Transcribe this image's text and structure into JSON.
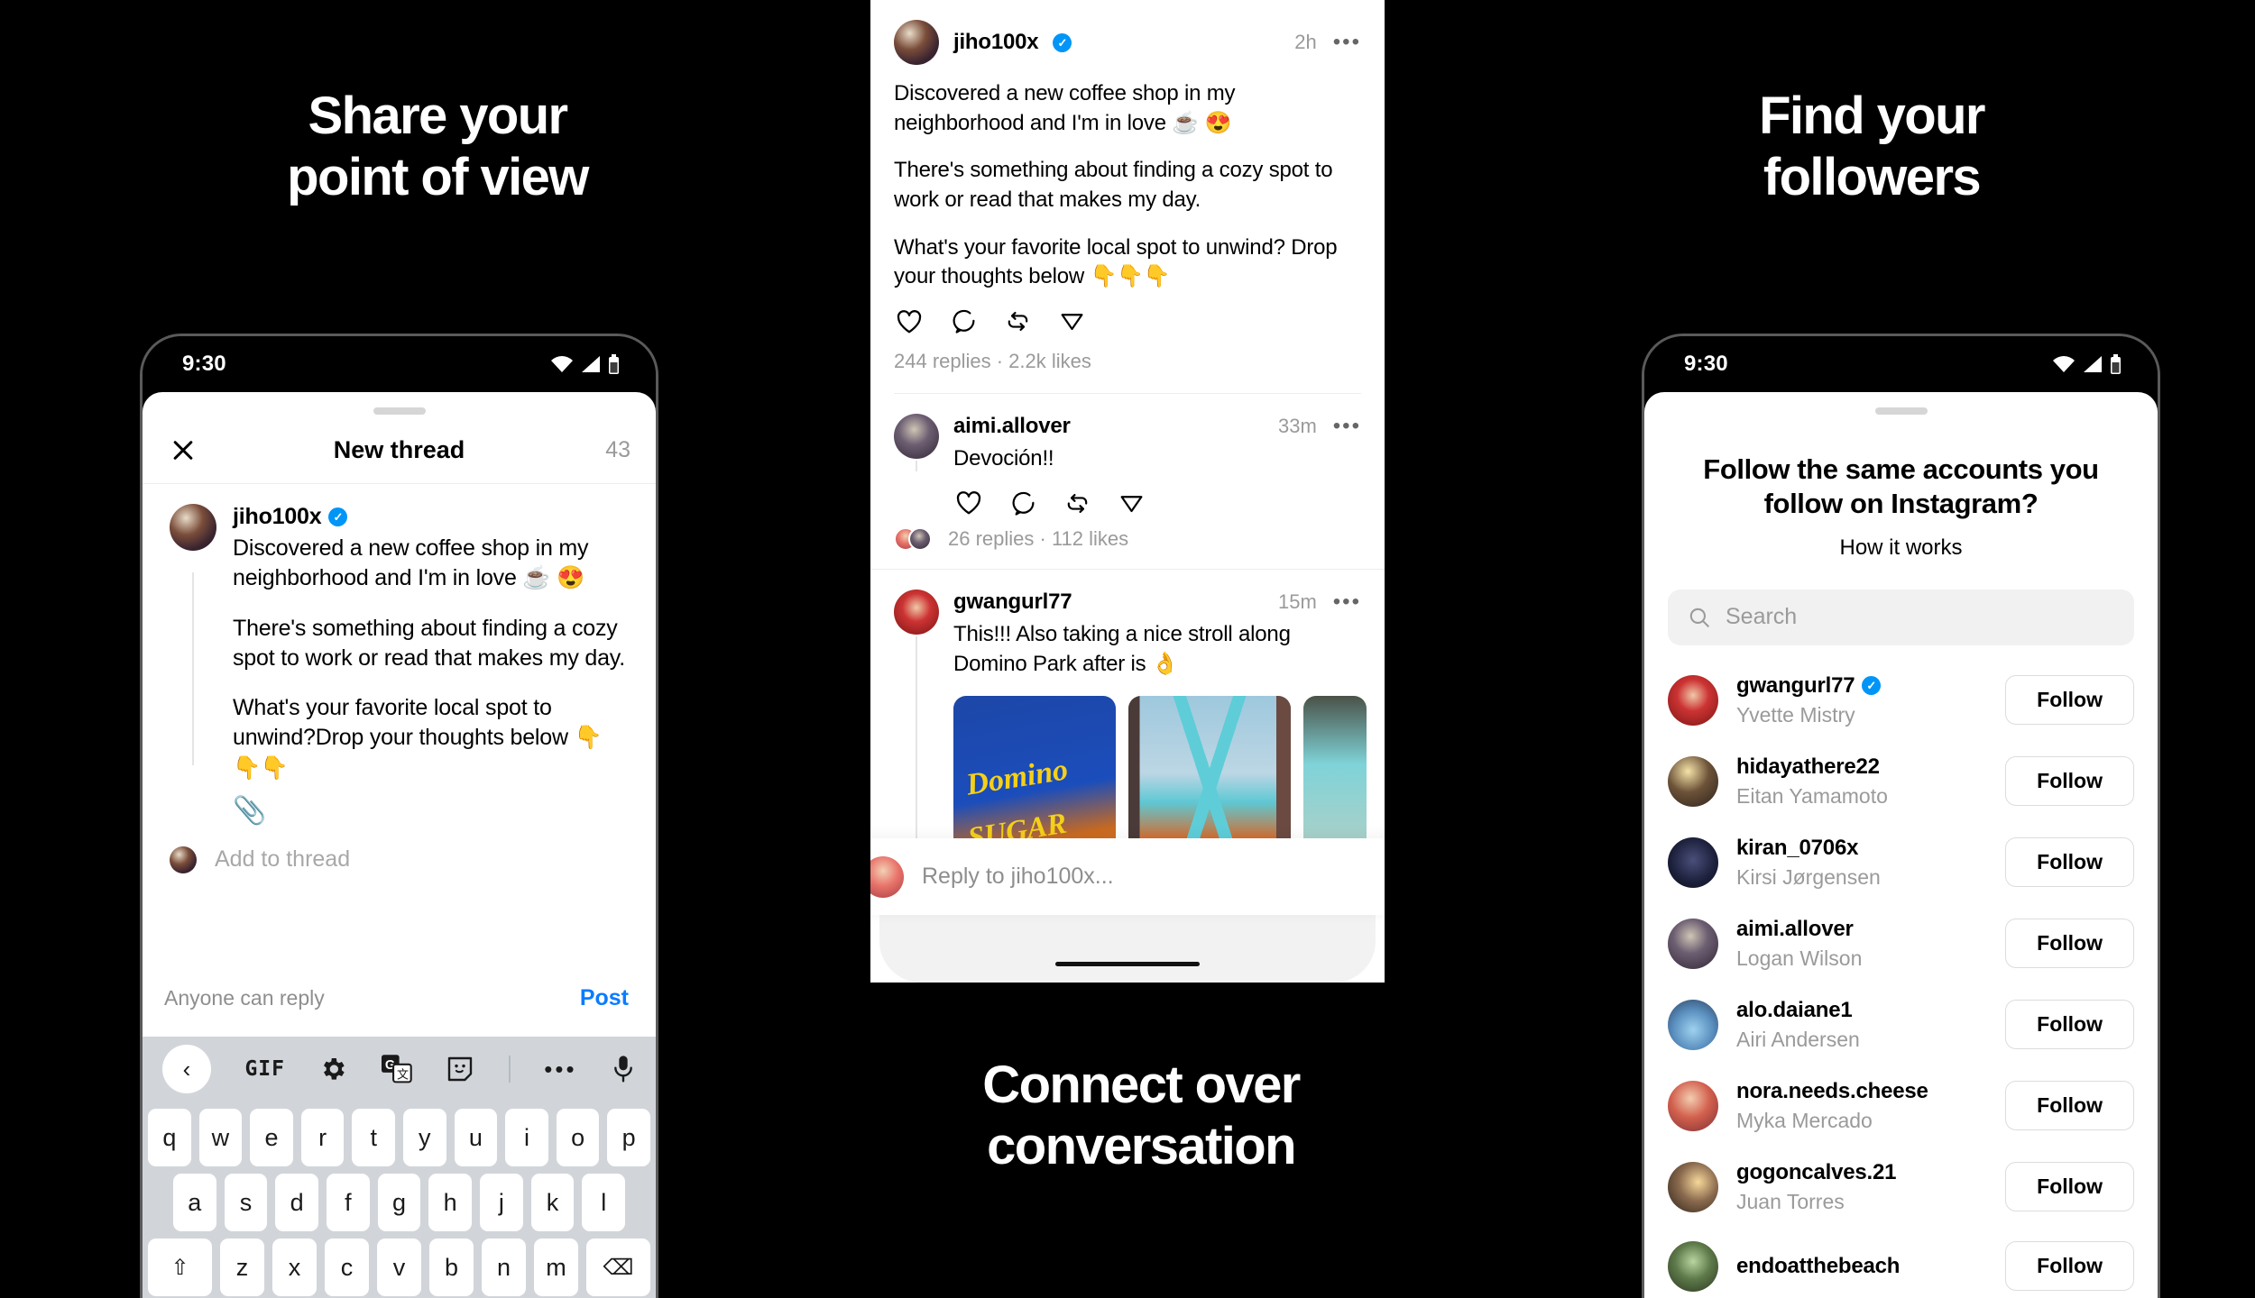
{
  "headlines": {
    "left": "Share your\npoint of view",
    "right": "Find your\nfollowers",
    "bottom": "Connect over\nconversation"
  },
  "status_bar": {
    "time": "9:30"
  },
  "composer": {
    "close_icon": "close-icon",
    "title": "New thread",
    "char_count": "43",
    "author": {
      "username": "jiho100x",
      "verified": true
    },
    "paragraphs": [
      "Discovered a new coffee shop in my neighborhood and I'm in love ☕ 😍",
      "There's something about finding a cozy spot to work or read that makes my day.",
      "What's your favorite local spot to unwind?Drop your thoughts below 👇👇👇"
    ],
    "attach_icon": "paperclip-icon",
    "add_to_thread": "Add to thread",
    "reply_policy": "Anyone can reply",
    "post_label": "Post",
    "post_color": "#0a7cff"
  },
  "keyboard": {
    "toolbar": [
      {
        "name": "keyboard-back-button",
        "label": "‹"
      },
      {
        "name": "gif-button",
        "label": "GIF"
      },
      {
        "name": "gear-icon",
        "label": ""
      },
      {
        "name": "translate-icon",
        "label": ""
      },
      {
        "name": "sticker-icon",
        "label": ""
      },
      {
        "name": "more-options-icon",
        "label": "•••"
      },
      {
        "name": "microphone-icon",
        "label": ""
      }
    ],
    "row1": [
      "q",
      "w",
      "e",
      "r",
      "t",
      "y",
      "u",
      "i",
      "o",
      "p"
    ],
    "row2": [
      "a",
      "s",
      "d",
      "f",
      "g",
      "h",
      "j",
      "k",
      "l"
    ],
    "row3_letters": [
      "z",
      "x",
      "c",
      "v",
      "b",
      "n",
      "m"
    ],
    "shift_label": "⇧",
    "backspace_label": "⌫"
  },
  "feed": {
    "post": {
      "username": "jiho100x",
      "verified": true,
      "time": "2h",
      "more": "•••",
      "paragraphs": [
        "Discovered a new coffee shop in my neighborhood and I'm in love ☕ 😍",
        "There's something about finding a cozy spot to work or read that makes my day.",
        "What's your favorite local spot to unwind? Drop your thoughts below 👇👇👇"
      ],
      "stats": "244 replies · 2.2k likes"
    },
    "replies": [
      {
        "username": "aimi.allover",
        "time": "33m",
        "more": "•••",
        "text": "Devoción!!",
        "stats": "26 replies · 112 likes",
        "has_media": false
      },
      {
        "username": "gwangurl77",
        "time": "15m",
        "more": "•••",
        "text": "This!!! Also taking a nice stroll along Domino Park after is 👌",
        "stats": "",
        "has_media": true,
        "media_caption": "SUGAR"
      }
    ],
    "reply_bar": {
      "placeholder": "Reply to jiho100x..."
    }
  },
  "follow_screen": {
    "title": "Follow the same accounts you follow on Instagram?",
    "how_it_works": "How it works",
    "search": {
      "icon": "search-icon",
      "placeholder": "Search"
    },
    "follow_label": "Follow",
    "accounts": [
      {
        "username": "gwangurl77",
        "name": "Yvette Mistry",
        "verified": true,
        "avatar": "av-c"
      },
      {
        "username": "hidayathere22",
        "name": "Eitan Yamamoto",
        "verified": false,
        "avatar": "av-e"
      },
      {
        "username": "kiran_0706x",
        "name": "Kirsi Jørgensen",
        "verified": false,
        "avatar": "av-f"
      },
      {
        "username": "aimi.allover",
        "name": "Logan Wilson",
        "verified": false,
        "avatar": "av-b"
      },
      {
        "username": "alo.daiane1",
        "name": "Airi Andersen",
        "verified": false,
        "avatar": "av-g"
      },
      {
        "username": "nora.needs.cheese",
        "name": "Myka Mercado",
        "verified": false,
        "avatar": "av-h"
      },
      {
        "username": "gogoncalves.21",
        "name": "Juan Torres",
        "verified": false,
        "avatar": "av-i"
      },
      {
        "username": "endoatthebeach",
        "name": "",
        "verified": false,
        "avatar": "av-j"
      }
    ]
  },
  "colors": {
    "background": "#000000",
    "accent_blue": "#0095f6",
    "post_blue": "#0a7cff"
  }
}
